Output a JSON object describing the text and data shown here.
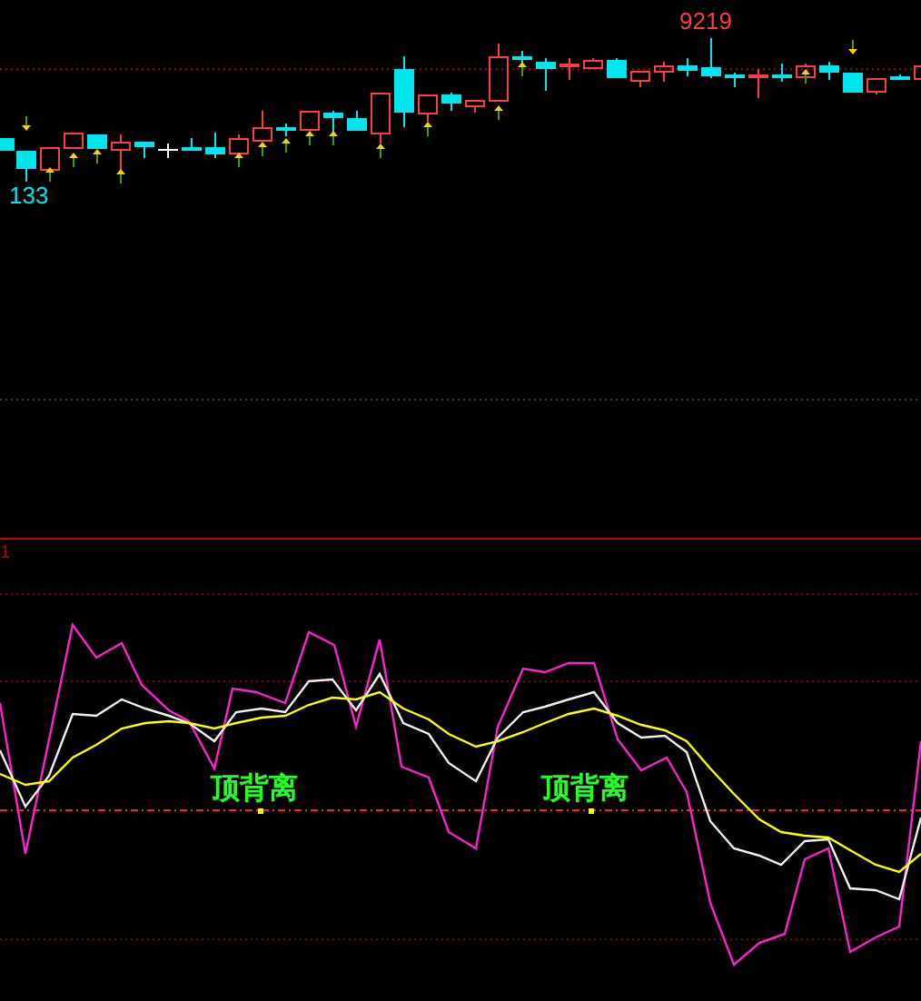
{
  "price_chart": {
    "high_label": "9219",
    "low_label": "133"
  },
  "indicator_panel": {
    "axis_label": "1",
    "signals": [
      {
        "label": "顶背离"
      },
      {
        "label": "顶背离"
      }
    ]
  }
}
